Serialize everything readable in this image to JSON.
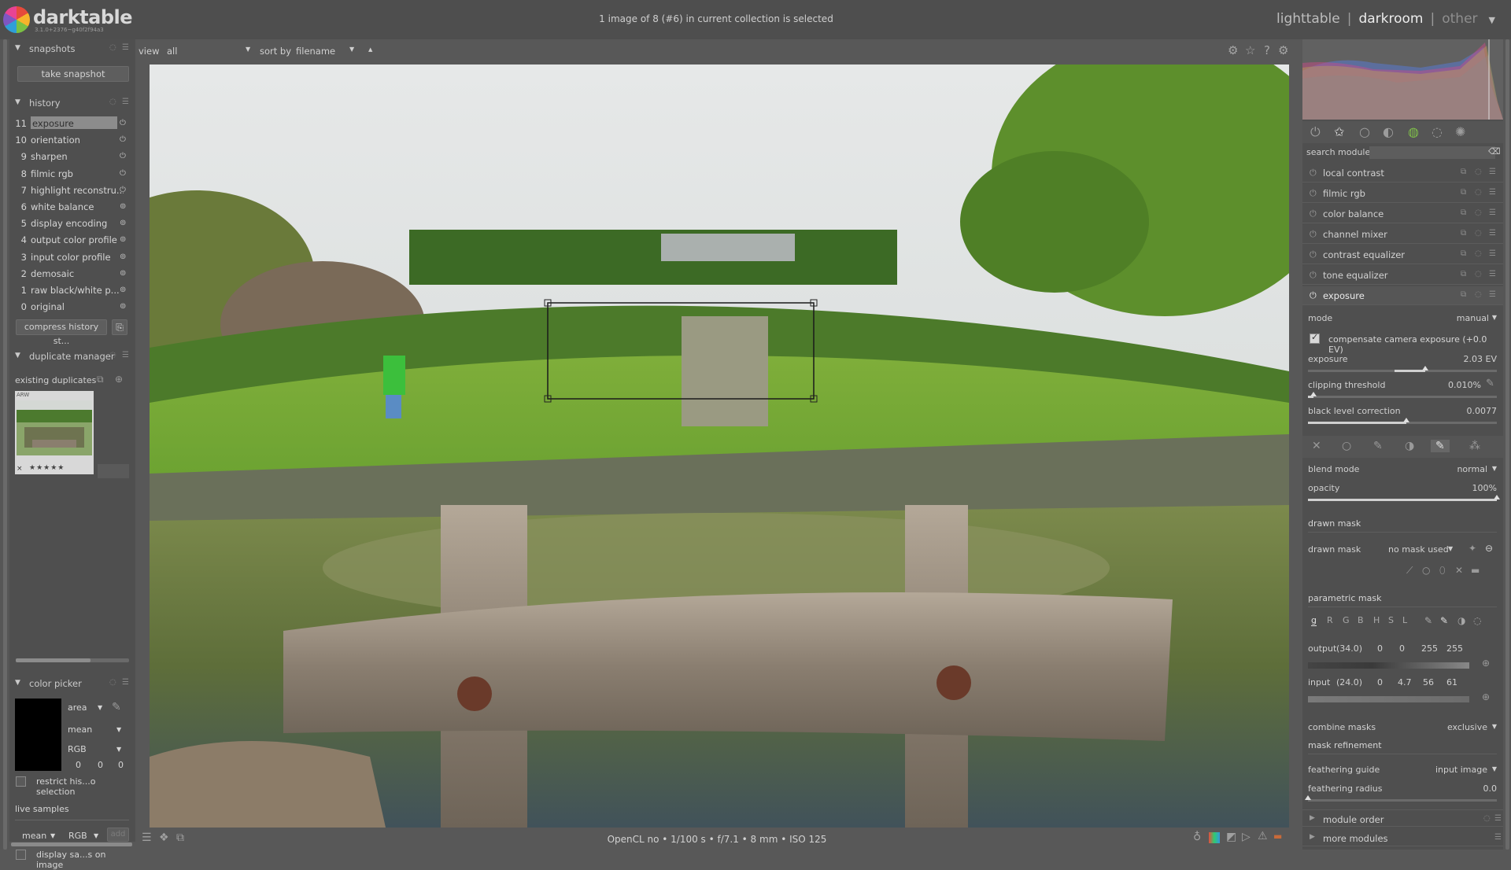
{
  "app": {
    "name": "darktable",
    "version": "3.1.0+2376~g40f2f94a3"
  },
  "top": {
    "status": "1 image of 8 (#6) in current collection is selected",
    "views": [
      "lighttable",
      "darkroom",
      "other"
    ],
    "active_view": "darkroom"
  },
  "left": {
    "snapshots": {
      "title": "snapshots",
      "button": "take snapshot"
    },
    "history": {
      "title": "history",
      "items": [
        {
          "n": "11",
          "label": "exposure",
          "selected": true
        },
        {
          "n": "10",
          "label": "orientation"
        },
        {
          "n": "9",
          "label": "sharpen"
        },
        {
          "n": "8",
          "label": "filmic rgb"
        },
        {
          "n": "7",
          "label": "highlight reconstru..."
        },
        {
          "n": "6",
          "label": "white balance"
        },
        {
          "n": "5",
          "label": "display encoding"
        },
        {
          "n": "4",
          "label": "output color profile"
        },
        {
          "n": "3",
          "label": "input color profile"
        },
        {
          "n": "2",
          "label": "demosaic"
        },
        {
          "n": "1",
          "label": "raw black/white p..."
        },
        {
          "n": "0",
          "label": "original"
        }
      ],
      "compress": "compress history st..."
    },
    "duplicates": {
      "title": "duplicate manager",
      "existing": "existing duplicates",
      "thumb_tag": "ARW",
      "thumb_mark": "×",
      "thumb_stars": "★★★★★"
    },
    "color_picker": {
      "title": "color picker",
      "mode": "area",
      "stat": "mean",
      "model": "RGB",
      "values": [
        "0",
        "0",
        "0"
      ],
      "restrict": "restrict his...o selection",
      "live_samples": "live samples",
      "live_stat": "mean",
      "live_model": "RGB",
      "add": "add",
      "display_samples": "display sa...s on image"
    }
  },
  "center": {
    "view_label": "view",
    "view_value": "all",
    "sort_label": "sort by",
    "sort_value": "filename",
    "sort_dir": "▲",
    "exif": "OpenCL no • 1/100 s • f/7.1 • 8 mm • ISO 125"
  },
  "right": {
    "search_label": "search module",
    "modules": [
      "local contrast",
      "filmic rgb",
      "color balance",
      "channel mixer",
      "contrast equalizer",
      "tone equalizer",
      "exposure"
    ],
    "active_module": "exposure",
    "exposure": {
      "mode_label": "mode",
      "mode_value": "manual",
      "compensate": "compensate camera exposure (+0.0 EV)",
      "exposure_label": "exposure",
      "exposure_value": "2.03 EV",
      "exposure_pos": 0.62,
      "clip_label": "clipping threshold",
      "clip_value": "0.010%",
      "clip_pos": 0.03,
      "black_label": "black level correction",
      "black_value": "0.0077",
      "black_pos": 0.52
    },
    "blend": {
      "mode_label": "blend mode",
      "mode_value": "normal",
      "opacity_label": "opacity",
      "opacity_value": "100%",
      "opacity_pos": 1.0,
      "drawn_header": "drawn mask",
      "drawn_label": "drawn mask",
      "drawn_value": "no mask used",
      "param_header": "parametric mask",
      "channels": [
        "g",
        "R",
        "G",
        "B",
        "H",
        "S",
        "L"
      ],
      "output_label": "output",
      "output_vals": [
        "(34.0)",
        "0",
        "0",
        "255",
        "255"
      ],
      "input_label": "input",
      "input_vals": [
        "(24.0)",
        "0",
        "4.7",
        "56",
        "61"
      ],
      "combine_label": "combine masks",
      "combine_value": "exclusive",
      "refine": "mask refinement",
      "guide_label": "feathering guide",
      "guide_value": "input image",
      "radius_label": "feathering radius",
      "radius_value": "0.0"
    },
    "footer": [
      "module order",
      "more modules"
    ]
  }
}
